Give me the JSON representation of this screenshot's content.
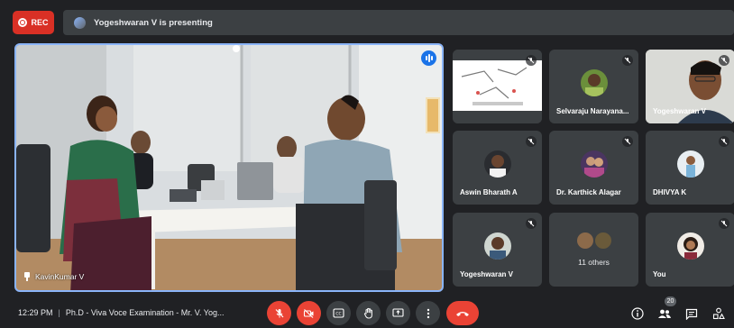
{
  "recording": {
    "label": "REC"
  },
  "presenting": {
    "text": "Yogeshwaran V is presenting"
  },
  "main_tile": {
    "name": "KavinKumar V"
  },
  "participants": [
    {
      "name": ""
    },
    {
      "name": "Selvaraju Narayana..."
    },
    {
      "name": "Yogeshwaran V"
    },
    {
      "name": "Aswin Bharath A"
    },
    {
      "name": "Dr. Karthick Alagar"
    },
    {
      "name": "DHIVYA K"
    },
    {
      "name": "Yogeshwaran V"
    },
    {
      "name": ""
    },
    {
      "name": "You"
    }
  ],
  "others": {
    "label": "11 others"
  },
  "meeting": {
    "time": "12:29 PM",
    "separator": "|",
    "title": "Ph.D - Viva Voce Examination - Mr. V. Yog..."
  },
  "people_count": "20",
  "icons": {
    "mic": "mic-off-icon",
    "camera": "camera-off-icon",
    "captions": "captions-icon",
    "raise_hand": "raise-hand-icon",
    "present": "present-screen-icon",
    "more": "more-options-icon",
    "hangup": "hang-up-icon",
    "info": "info-icon",
    "people": "people-icon",
    "chat": "chat-icon",
    "activities": "activities-icon"
  },
  "colors": {
    "background": "#202124",
    "tile": "#3c4043",
    "accent": "#8ab4f8",
    "danger": "#ea4335",
    "rec": "#d93025"
  }
}
